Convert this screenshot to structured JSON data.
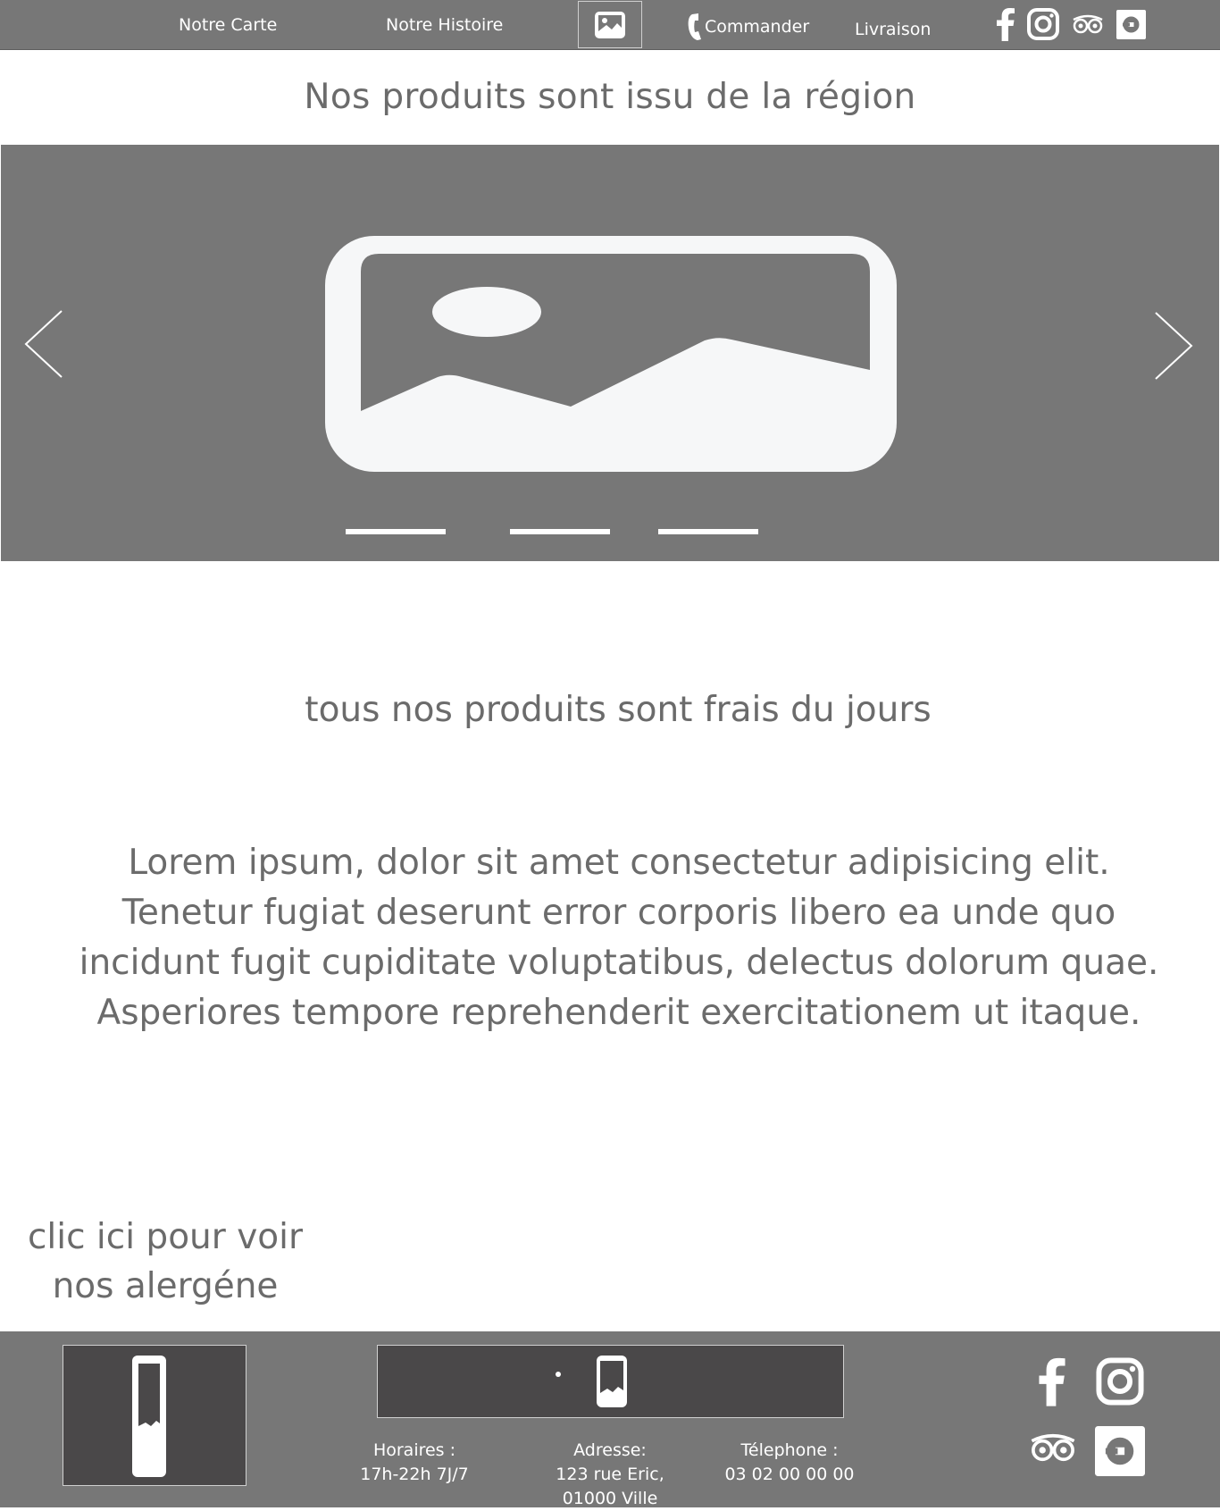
{
  "nav": {
    "items": [
      "Notre Carte",
      "Notre Histoire",
      "Commander",
      "Livraison"
    ],
    "icons": [
      "image-icon",
      "phone-icon",
      "facebook-icon",
      "instagram-icon",
      "tripadvisor-icon",
      "ubereats-icon"
    ]
  },
  "main": {
    "title": "Nos produits sont issu de la région",
    "subtitle": "tous nos produits sont frais du jours",
    "body": "Lorem ipsum, dolor sit amet consectetur adipisicing elit. Tenetur fugiat deserunt error corporis libero ea unde quo incidunt fugit cupiditate voluptatibus, delectus dolorum quae. Asperiores tempore reprehenderit exercitationem ut itaque.",
    "allergen_line1": "clic ici pour voir",
    "allergen_line2": "nos alergéne"
  },
  "carousel": {
    "slides": 3,
    "icons": [
      "chevron-left-icon",
      "image-placeholder-icon",
      "chevron-right-icon"
    ]
  },
  "footer": {
    "hours_label": "Horaires :",
    "hours_value": "17h-22h  7J/7",
    "address_label": "Adresse:",
    "address_line1": "123 rue  Eric,",
    "address_line2": "01000 Ville",
    "phone_label": "Télephone :",
    "phone_value": "03 02 00 00 00",
    "icons": [
      "facebook-icon",
      "instagram-icon",
      "tripadvisor-icon",
      "ubereats-icon"
    ]
  },
  "colors": {
    "bar": "#777777",
    "dark_box": "#4a4849",
    "text": "#6b6b6b",
    "icon": "#ffffff"
  }
}
